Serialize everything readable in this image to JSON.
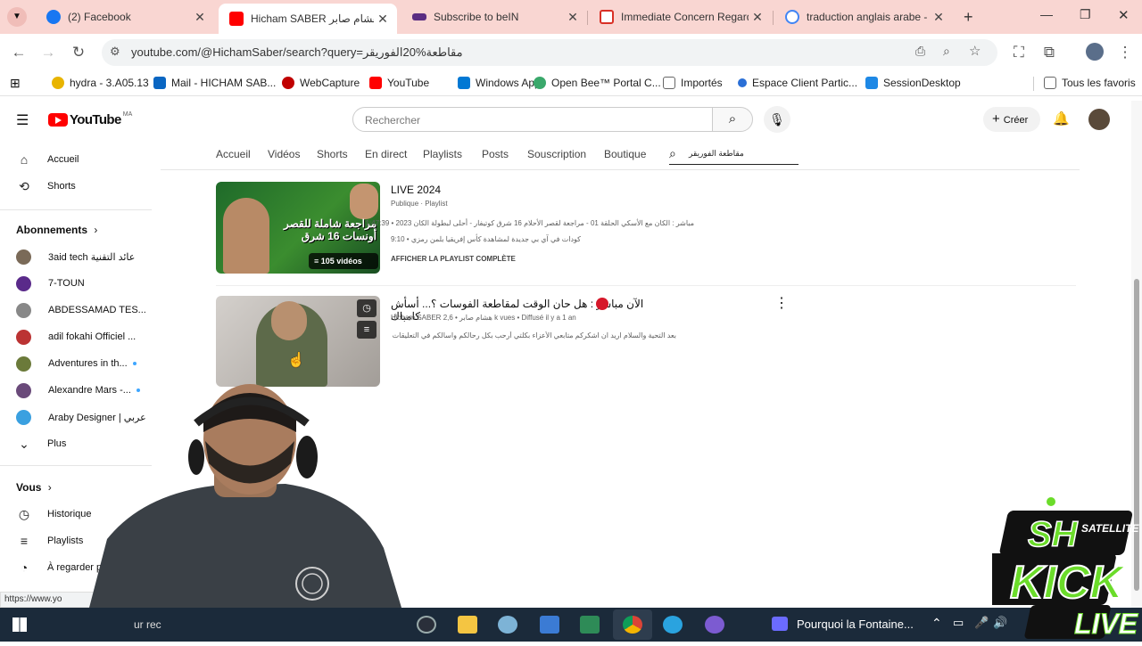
{
  "browser": {
    "tabs": [
      {
        "title": "(2) Facebook",
        "color": "#1877f2"
      },
      {
        "title": "Hicham SABER هشام صابر - YouTube",
        "color": "#ff0000"
      },
      {
        "title": "Subscribe to beIN",
        "color": "#5b2d82"
      },
      {
        "title": "Immediate Concern Regarding",
        "color": "#d93025"
      },
      {
        "title": "traduction anglais arabe - Re",
        "color": "#4285f4"
      }
    ],
    "url": "youtube.com/@HichamSaber/search?query=مقاطعة%20الفوريقر",
    "bookmarks": [
      {
        "label": "hydra - 3.A05.13",
        "color": "#e8b400"
      },
      {
        "label": "Mail - HICHAM SAB...",
        "color": "#0a66c2"
      },
      {
        "label": "WebCapture",
        "color": "#c00000"
      },
      {
        "label": "YouTube",
        "color": "#ff0000"
      },
      {
        "label": "Windows App",
        "color": "#0078d4"
      },
      {
        "label": "Open Bee™ Portal C...",
        "color": "#3aa86b"
      },
      {
        "label": "Importés",
        "color": "#666666"
      },
      {
        "label": "Espace Client Partic...",
        "color": "#2a6fd6"
      },
      {
        "label": "SessionDesktop",
        "color": "#1e88e5"
      }
    ],
    "bookmarks_all": "Tous les favoris",
    "status_url": "https://www.yo"
  },
  "youtube": {
    "logo_text": "YouTube",
    "logo_region": "MA",
    "search_placeholder": "Rechercher",
    "create_label": "Créer",
    "sidebar": {
      "main": [
        {
          "label": "Accueil",
          "icon": "home-icon"
        },
        {
          "label": "Shorts",
          "icon": "shorts-icon"
        }
      ],
      "subs_heading": "Abonnements",
      "subs": [
        {
          "label": "3aid tech عائد التقنية",
          "color": "#7a6a58",
          "dot": false
        },
        {
          "label": "7-TOUN",
          "color": "#5a2a8a",
          "dot": false
        },
        {
          "label": "ABDESSAMAD TES...",
          "color": "#888888",
          "dot": false
        },
        {
          "label": "adil fokahi Officiel ...",
          "color": "#b33",
          "dot": false
        },
        {
          "label": "Adventures in th...",
          "color": "#6b7a3a",
          "dot": true
        },
        {
          "label": "Alexandre Mars -...",
          "color": "#6a4a7a",
          "dot": true
        },
        {
          "label": "Araby Designer | عربي",
          "color": "#3aa0e0",
          "dot": false
        }
      ],
      "more_label": "Plus",
      "you_heading": "Vous",
      "you": [
        {
          "label": "Historique",
          "icon": "history-icon"
        },
        {
          "label": "Playlists",
          "icon": "playlists-icon"
        },
        {
          "label": "À regarder plus",
          "icon": "watch-later-icon"
        }
      ]
    },
    "channel_tabs": [
      "Accueil",
      "Vidéos",
      "Shorts",
      "En direct",
      "Playlists",
      "Posts",
      "Souscription",
      "Boutique"
    ],
    "channel_search_query": "مقاطعة الفوريقر",
    "results": [
      {
        "title": "LIVE 2024",
        "subtitle": "Publique · Playlist",
        "badge": "105 vidéos",
        "line1": "مباشر : الكان مع الأسكي الحلقة 01 - مراجعة لقصر الأحلام 16 شرق كوتيفار - أحلى لبطولة الكان 2023 • 1:47:39",
        "line2": "كودات في آي بي جديدة لمشاهدة كأس إفريقيا بلمن رمزي • 9:10",
        "action": "AFFICHER LA PLAYLIST COMPLÈTE",
        "thumb_text": "مراجعة شاملة للقصر أونسات 16 شرق"
      },
      {
        "title": "الآن مباشر : هل حان الوقت لمقاطعة الفوسات ؟... أسأش كامباك",
        "meta": "Hicham SABER هشام صابر • 2,6 k vues • Diffusé il y a 1 an",
        "desc": "بعد التحية والسلام اريد ان اشكركم متابعي الأعزاء بكلتي أرحب بكل رحالكم واسالكم في التعليقات لتعزيز قنوات..."
      }
    ]
  },
  "taskbar": {
    "media_title": "Pourquoi la Fontaine...",
    "search_text": "ur rec"
  },
  "overlay": {
    "line1": "SH",
    "line2": "SATELLITE",
    "line3": "KICK",
    "line4": "LIVE"
  }
}
